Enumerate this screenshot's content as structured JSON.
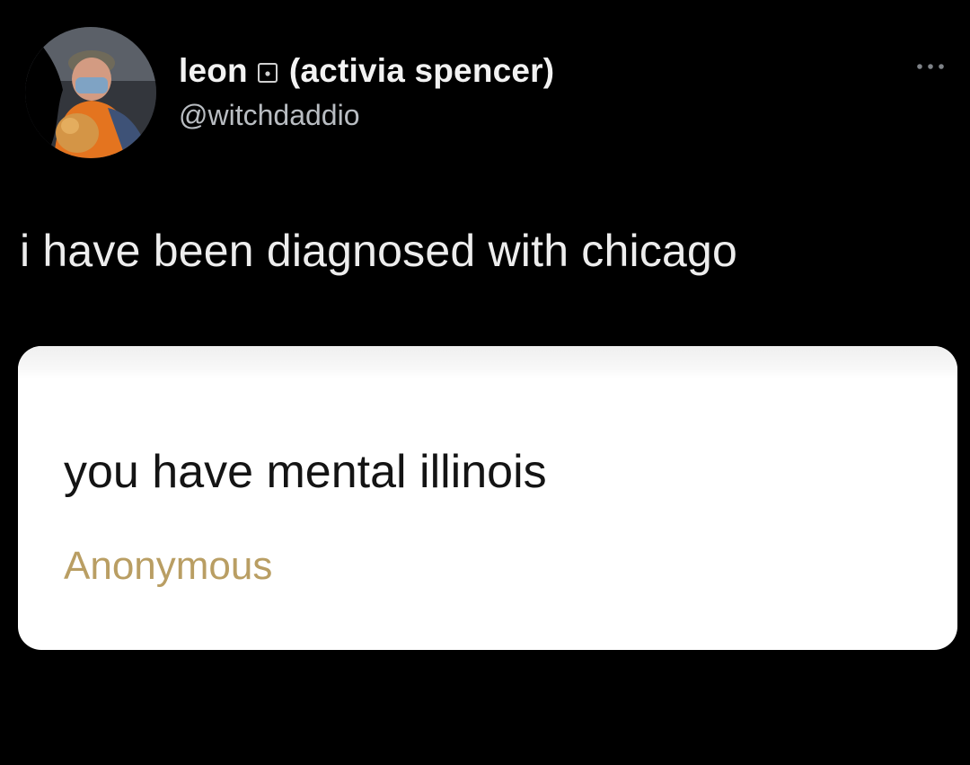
{
  "user": {
    "display_name": "leon",
    "name_suffix": "(activia spencer)",
    "handle": "@witchdaddio",
    "avatar_icon": "user-avatar-photo"
  },
  "icons": {
    "more": "more-horizontal-icon",
    "name_emoji": "square-dot-icon"
  },
  "tweet": {
    "text": "i have been diagnosed with chicago"
  },
  "embedded_card": {
    "question": "you have mental illinois",
    "author": "Anonymous"
  },
  "colors": {
    "background": "#000000",
    "card_background": "#ffffff",
    "author_label": "#b99e63"
  }
}
